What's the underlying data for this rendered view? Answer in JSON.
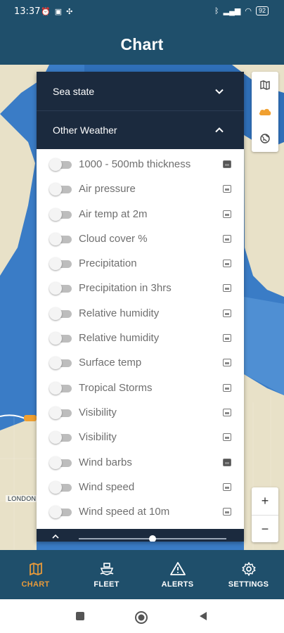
{
  "status_bar": {
    "time": "13:37",
    "battery": "92"
  },
  "app_bar": {
    "title": "Chart"
  },
  "map": {
    "place_label": "LONDON"
  },
  "panel": {
    "sections": [
      {
        "label": "Sea state",
        "expanded": false
      },
      {
        "label": "Other Weather",
        "expanded": true
      }
    ],
    "layers": [
      {
        "label": "1000 - 500mb thickness",
        "enabled": false,
        "legend_icon": "image-icon-dark"
      },
      {
        "label": "Air pressure",
        "enabled": false,
        "legend_icon": "legend-icon"
      },
      {
        "label": "Air temp at 2m",
        "enabled": false,
        "legend_icon": "legend-icon"
      },
      {
        "label": "Cloud cover %",
        "enabled": false,
        "legend_icon": "legend-icon"
      },
      {
        "label": "Precipitation",
        "enabled": false,
        "legend_icon": "legend-icon"
      },
      {
        "label": "Precipitation in 3hrs",
        "enabled": false,
        "legend_icon": "legend-icon"
      },
      {
        "label": "Relative humidity",
        "enabled": false,
        "legend_icon": "legend-icon"
      },
      {
        "label": "Relative humidity",
        "enabled": false,
        "legend_icon": "legend-icon"
      },
      {
        "label": "Surface temp",
        "enabled": false,
        "legend_icon": "legend-icon"
      },
      {
        "label": "Tropical Storms",
        "enabled": false,
        "legend_icon": "legend-icon"
      },
      {
        "label": "Visibility",
        "enabled": false,
        "legend_icon": "legend-icon"
      },
      {
        "label": "Visibility",
        "enabled": false,
        "legend_icon": "legend-icon"
      },
      {
        "label": "Wind barbs",
        "enabled": false,
        "legend_icon": "image-icon-dark"
      },
      {
        "label": "Wind speed",
        "enabled": false,
        "legend_icon": "legend-icon"
      },
      {
        "label": "Wind speed at 10m",
        "enabled": false,
        "legend_icon": "legend-icon"
      }
    ]
  },
  "map_controls": [
    "map-icon",
    "cloud-icon",
    "globe-icon"
  ],
  "zoom": {
    "in": "+",
    "out": "−"
  },
  "bottom_nav": [
    {
      "label": "CHART",
      "icon": "map-icon",
      "active": true
    },
    {
      "label": "FLEET",
      "icon": "ship-icon",
      "active": false
    },
    {
      "label": "ALERTS",
      "icon": "warning-icon",
      "active": false
    },
    {
      "label": "SETTINGS",
      "icon": "gear-icon",
      "active": false
    }
  ],
  "colors": {
    "app_bar": "#1f4f6b",
    "panel_header": "#1b2a3e",
    "sea": "#3a7cc6",
    "land": "#e8e1c8",
    "active_nav": "#e89a3a",
    "cloud_control": "#f0a030"
  }
}
